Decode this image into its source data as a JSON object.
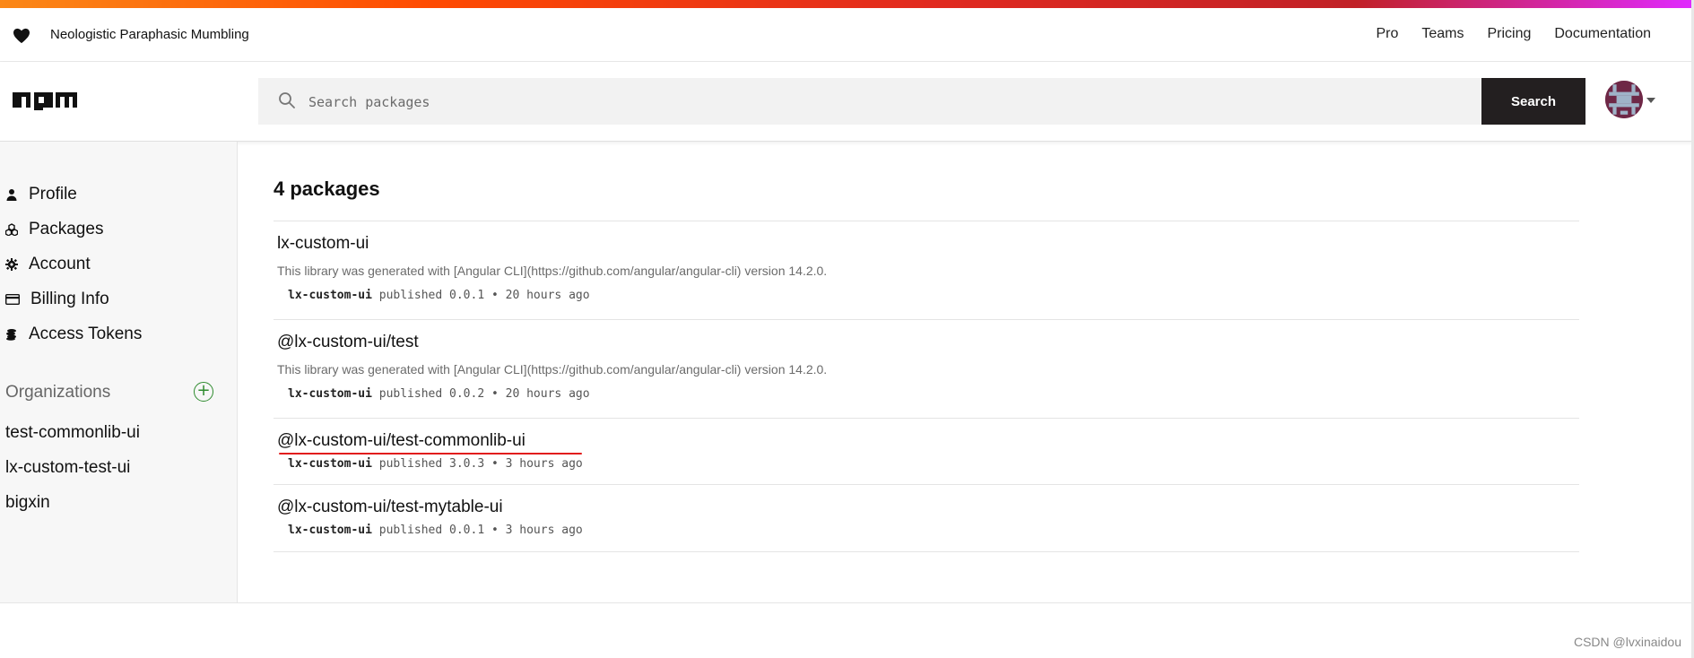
{
  "top_nav": {
    "tagline": "Neologistic Paraphasic Mumbling",
    "links": [
      "Pro",
      "Teams",
      "Pricing",
      "Documentation"
    ]
  },
  "header": {
    "logo": "npm",
    "search_placeholder": "Search packages",
    "search_button": "Search"
  },
  "sidebar": {
    "items": [
      {
        "label": "Profile",
        "icon": "user-icon"
      },
      {
        "label": "Packages",
        "icon": "packages-icon"
      },
      {
        "label": "Account",
        "icon": "gear-icon"
      },
      {
        "label": "Billing Info",
        "icon": "credit-card-icon"
      },
      {
        "label": "Access Tokens",
        "icon": "coins-icon"
      }
    ],
    "organizations_title": "Organizations",
    "organizations_add": "+",
    "organizations": [
      "test-commonlib-ui",
      "lx-custom-test-ui",
      "bigxin"
    ]
  },
  "main": {
    "package_count": "4 packages",
    "packages": [
      {
        "name": "lx-custom-ui",
        "description": "This library was generated with [Angular CLI](https://github.com/angular/angular-cli) version 14.2.0.",
        "publisher": "lx-custom-ui",
        "meta": "published 0.0.1 • 20 hours ago"
      },
      {
        "name": "@lx-custom-ui/test",
        "description": "This library was generated with [Angular CLI](https://github.com/angular/angular-cli) version 14.2.0.",
        "publisher": "lx-custom-ui",
        "meta": "published 0.0.2 • 20 hours ago"
      },
      {
        "name": "@lx-custom-ui/test-commonlib-ui",
        "description": "",
        "publisher": "lx-custom-ui",
        "meta": "published 3.0.3 • 3 hours ago"
      },
      {
        "name": "@lx-custom-ui/test-mytable-ui",
        "description": "",
        "publisher": "lx-custom-ui",
        "meta": "published 0.0.1 • 3 hours ago"
      }
    ]
  },
  "watermark": "CSDN @lvxinaidou",
  "colors": {
    "accent_red": "#e21d1d",
    "search_button_bg": "#231f20",
    "org_add_green": "#2e8b2e"
  }
}
